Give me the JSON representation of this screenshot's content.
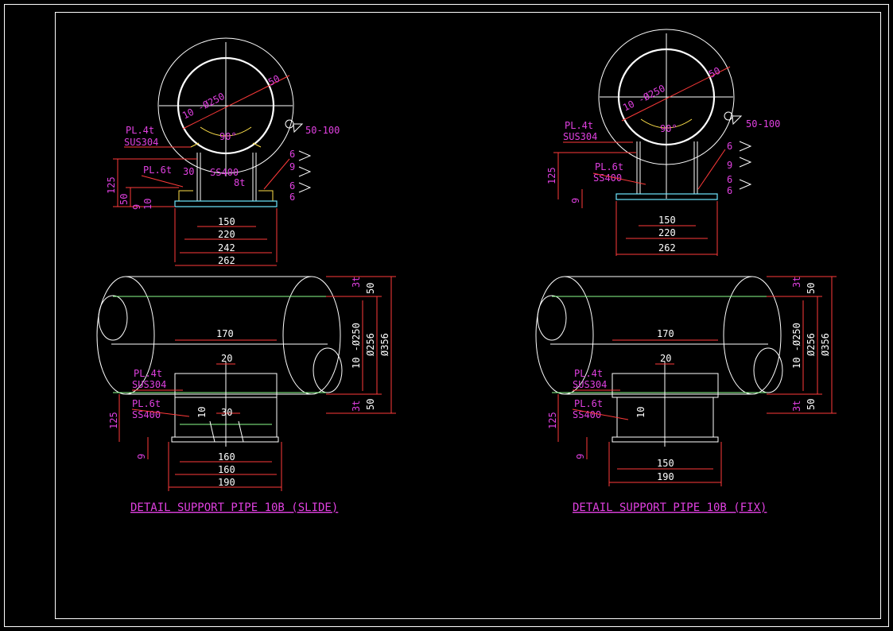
{
  "colors": {
    "background": "#000000",
    "outline": "#ffffff",
    "dimension_line": "#ff3a3a",
    "label": "#e040e0",
    "weld": "#ffe14a",
    "pipe_edge": "#8cff8c",
    "base_plate": "#6fe7ff"
  },
  "slide": {
    "title": "DETAIL SUPPORT PIPE 10B (SLIDE)",
    "top": {
      "pipe_dia": "10 -Ø250",
      "insul_thk": "50",
      "angle": "90°",
      "weld_range": "50-100",
      "weld_6a": "6",
      "weld_9": "9",
      "weld_6b": "6",
      "weld_6c": "6",
      "pl4t": "PL.4t",
      "sus304": "SUS304",
      "pl6t": "PL.6t",
      "ss400": "SS400",
      "gap_30": "30",
      "thk_8t": "8t",
      "h125": "125",
      "h50": "50",
      "h9": "9",
      "h10": "10",
      "w150": "150",
      "w220": "220",
      "w242": "242",
      "w262": "262"
    },
    "side": {
      "w170": "170",
      "w20": "20",
      "w30": "30",
      "v10": "10",
      "pl4t": "PL.4t",
      "sus304": "SUS304",
      "pl6t": "PL.6t",
      "ss400": "SS400",
      "h125": "125",
      "h9": "9",
      "w160a": "160",
      "w160b": "160",
      "w190": "190",
      "t3_top": "3t",
      "t3_bot": "3t",
      "v50_top": "50",
      "v50_bot": "50",
      "v250": "10 -Ø250",
      "v256": "Ø256",
      "v356": "Ø356"
    }
  },
  "fix": {
    "title": "DETAIL SUPPORT PIPE 10B (FIX)",
    "top": {
      "pipe_dia": "10 -Ø250",
      "insul_thk": "50",
      "angle": "90°",
      "weld_range": "50-100",
      "weld_6a": "6",
      "weld_9": "9",
      "weld_6b": "6",
      "weld_6c": "6",
      "pl4t": "PL.4t",
      "sus304": "SUS304",
      "pl6t": "PL.6t",
      "ss400": "SS400",
      "h125": "125",
      "h9": "9",
      "w150": "150",
      "w220": "220",
      "w262": "262"
    },
    "side": {
      "w170": "170",
      "w20": "20",
      "v10": "10",
      "pl4t": "PL.4t",
      "sus304": "SUS304",
      "pl6t": "PL.6t",
      "ss400": "SS400",
      "h125": "125",
      "h9": "9",
      "w150": "150",
      "w190": "190",
      "t3_top": "3t",
      "t3_bot": "3t",
      "v50_top": "50",
      "v50_bot": "50",
      "v250": "10 -Ø250",
      "v256": "Ø256",
      "v356": "Ø356"
    }
  }
}
